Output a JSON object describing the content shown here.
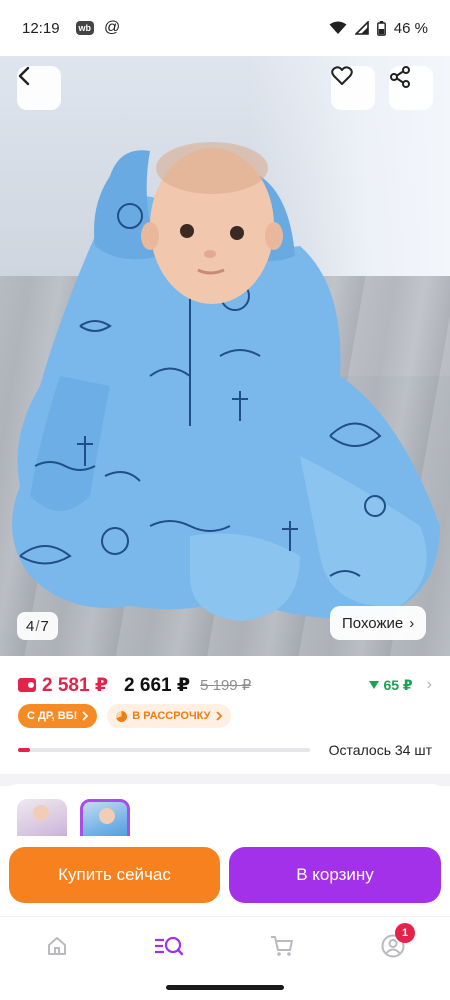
{
  "status_bar": {
    "time": "12:19",
    "app_badge": "wb",
    "notification_symbol": "@",
    "battery": "46 %"
  },
  "gallery": {
    "image_counter_current": "4",
    "image_counter_separator": "/",
    "image_counter_total": "7",
    "similar_label": "Похожие",
    "similar_chevron": "›"
  },
  "price": {
    "wallet_price": "2 581 ₽",
    "price": "2 661 ₽",
    "old_price": "5 199 ₽",
    "cashback": "65 ₽",
    "cashback_color": "#19a352",
    "accent_red": "#e5224a"
  },
  "badges": {
    "birthday": "С ДР, ВБ!",
    "installments": "В РАССРОЧКУ"
  },
  "stock": {
    "text": "Осталось 34 шт",
    "fill_fraction": 0.04
  },
  "variants": [
    {
      "name": "lilac-variant"
    },
    {
      "name": "blue-variant",
      "selected": true
    }
  ],
  "actions": {
    "buy_now": "Купить сейчас",
    "add_to_cart": "В корзину",
    "buy_color": "#f7801f",
    "cart_color": "#a231e9"
  },
  "tab_bar": {
    "profile_badge": "1",
    "items": [
      "home-icon",
      "catalog-search-icon",
      "cart-icon",
      "profile-icon"
    ]
  }
}
